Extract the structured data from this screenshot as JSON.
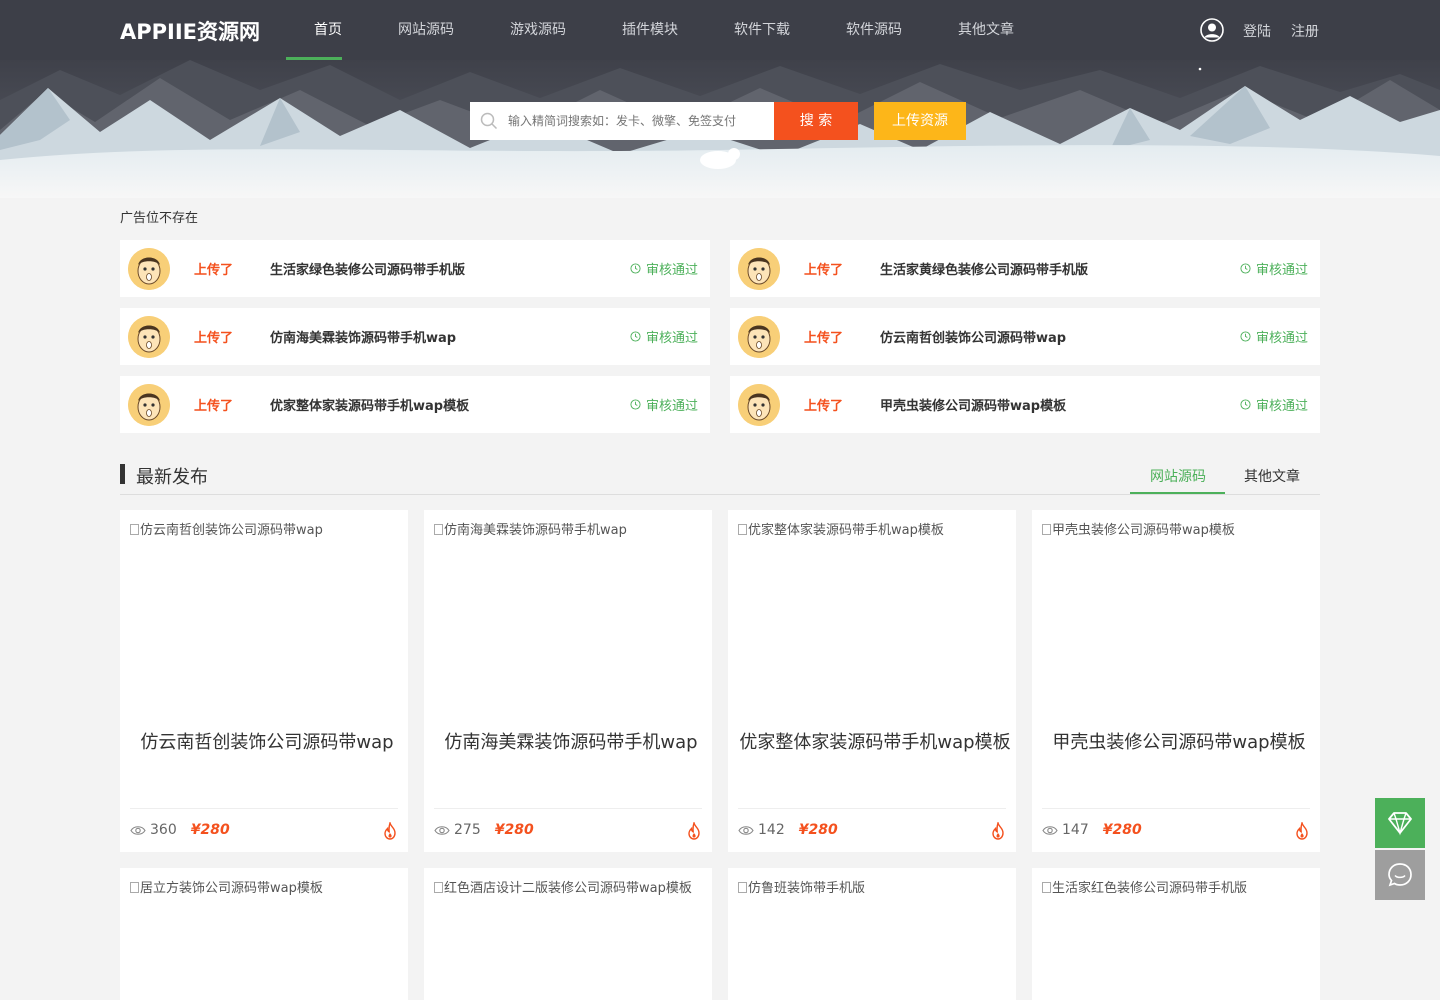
{
  "header": {
    "logo": "APPIIE资源网",
    "nav": [
      "首页",
      "网站源码",
      "游戏源码",
      "插件模块",
      "软件下载",
      "软件源码",
      "其他文章"
    ],
    "login": "登陆",
    "register": "注册"
  },
  "search": {
    "placeholder": "输入精简词搜索如：发卡、微擎、免签支付",
    "search_label": "搜 索",
    "upload_label": "上传资源"
  },
  "ad_notice": "广告位不存在",
  "feed": [
    {
      "action": "上传了",
      "title": "生活家绿色装修公司源码带手机版",
      "status": "审核通过"
    },
    {
      "action": "上传了",
      "title": "生活家黄绿色装修公司源码带手机版",
      "status": "审核通过"
    },
    {
      "action": "上传了",
      "title": "仿南海美霖装饰源码带手机wap",
      "status": "审核通过"
    },
    {
      "action": "上传了",
      "title": "仿云南哲创装饰公司源码带wap",
      "status": "审核通过"
    },
    {
      "action": "上传了",
      "title": "优家整体家装源码带手机wap模板",
      "status": "审核通过"
    },
    {
      "action": "上传了",
      "title": "甲壳虫装修公司源码带wap模板",
      "status": "审核通过"
    }
  ],
  "latest": {
    "title": "最新发布",
    "tabs": [
      "网站源码",
      "其他文章"
    ]
  },
  "products": [
    {
      "alt": "仿云南哲创装饰公司源码带wap",
      "title": "仿云南哲创装饰公司源码带wap",
      "views": "360",
      "price": "¥280"
    },
    {
      "alt": "仿南海美霖装饰源码带手机wap",
      "title": "仿南海美霖装饰源码带手机wap",
      "views": "275",
      "price": "¥280"
    },
    {
      "alt": "优家整体家装源码带手机wap模板",
      "title": "优家整体家装源码带手机wap模板",
      "views": "142",
      "price": "¥280"
    },
    {
      "alt": "甲壳虫装修公司源码带wap模板",
      "title": "甲壳虫装修公司源码带wap模板",
      "views": "147",
      "price": "¥280"
    },
    {
      "alt": "居立方装饰公司源码带wap模板"
    },
    {
      "alt": "红色酒店设计二版装修公司源码带wap模板"
    },
    {
      "alt": "仿鲁班装饰带手机版"
    },
    {
      "alt": "生活家红色装修公司源码带手机版"
    }
  ],
  "colors": {
    "accent": "#4cb05a",
    "orange": "#f4511e",
    "yellow": "#fdb619",
    "topbar": "#3d3f48"
  },
  "icons": {
    "float_1": "diamond-icon",
    "float_2": "chat-icon"
  }
}
